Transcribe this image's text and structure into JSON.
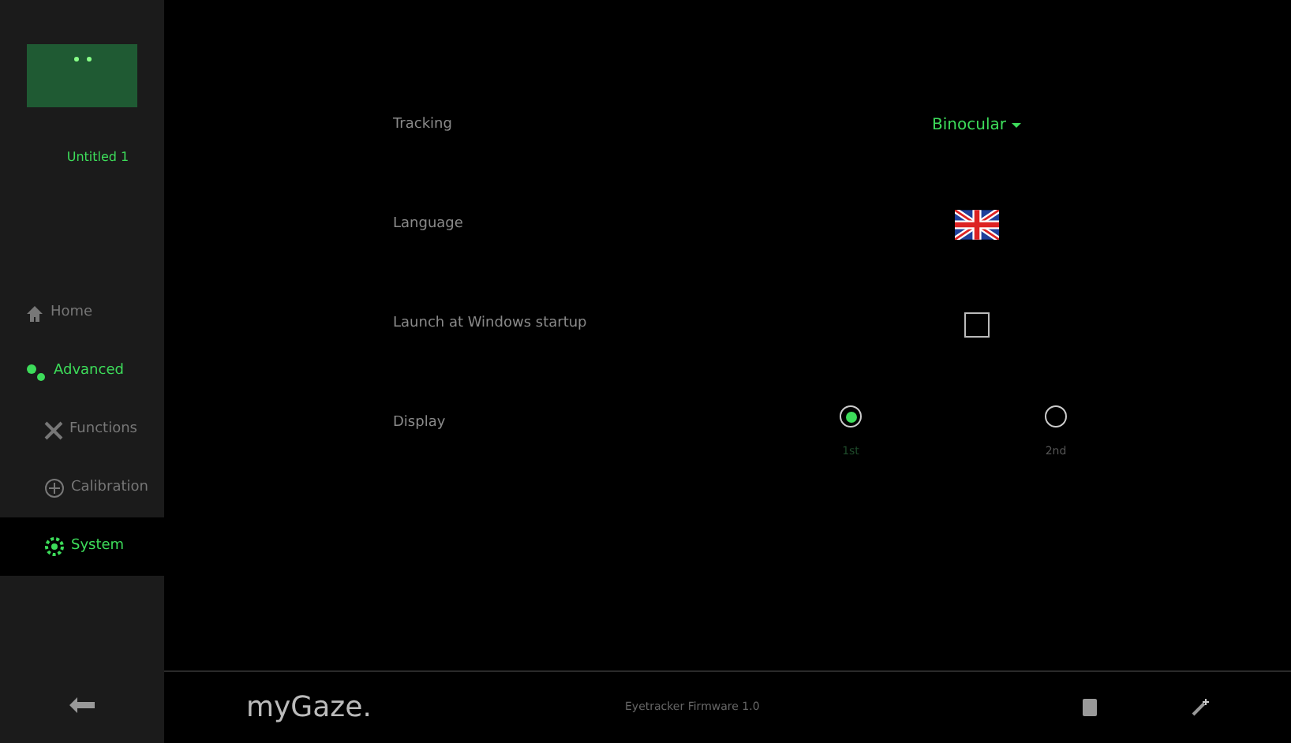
{
  "profile": {
    "name": "Untitled 1"
  },
  "nav": [
    {
      "label": "Home",
      "kind": "home",
      "selected": false
    },
    {
      "label": "Advanced",
      "kind": "advanced",
      "selected": false
    },
    {
      "label": "Functions",
      "kind": "functions",
      "selected": false
    },
    {
      "label": "Calibration",
      "kind": "calibration",
      "selected": false
    },
    {
      "label": "System",
      "kind": "system",
      "selected": true
    }
  ],
  "settings": [
    {
      "kind": "dropdown",
      "label": "Tracking",
      "value": "Binocular"
    },
    {
      "kind": "flag",
      "label": "Language"
    },
    {
      "kind": "checkbox",
      "label": "Launch at Windows startup",
      "checked": false
    },
    {
      "kind": "radio",
      "label": "Display",
      "options": [
        {
          "label": "1st",
          "selected": true
        },
        {
          "label": "2nd",
          "selected": false
        }
      ]
    }
  ],
  "footer": {
    "logo": "myGaze.",
    "status": "Eyetracker Firmware 1.0"
  }
}
